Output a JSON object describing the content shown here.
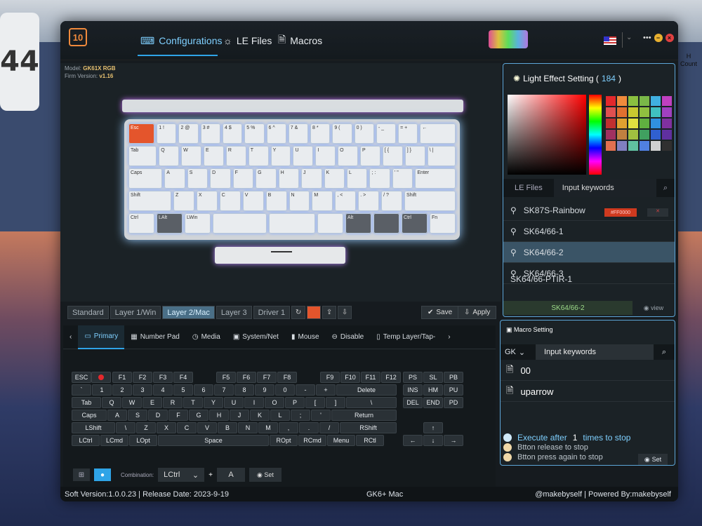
{
  "desktop": {
    "widget_number": "44",
    "right_label_1": "H",
    "right_label_2": "Count"
  },
  "app": {
    "logo": "10",
    "tabs": [
      {
        "label": "Configurations"
      },
      {
        "label": "LE Files"
      },
      {
        "label": "Macros"
      }
    ],
    "model_label": "Model:",
    "model_value": "GK61X RGB",
    "firm_label": "Firm Version:",
    "firm_value": "v1.16",
    "window_buttons": [
      "•••",
      "−",
      "×"
    ]
  },
  "keyboard": {
    "rows": [
      [
        "Esc",
        "1 !",
        "2 @",
        "3 #",
        "4 $",
        "5 %",
        "6 ^",
        "7 &",
        "8 *",
        "9 (",
        "0 )",
        "- _",
        "= +",
        "←"
      ],
      [
        "Tab",
        "Q",
        "W",
        "E",
        "R",
        "T",
        "Y",
        "U",
        "I",
        "O",
        "P",
        "[ {",
        "] }",
        "\\ |"
      ],
      [
        "Caps",
        "A",
        "S",
        "D",
        "F",
        "G",
        "H",
        "J",
        "K",
        "L",
        "; :",
        "' \"",
        "Enter"
      ],
      [
        "Shift",
        "Z",
        "X",
        "C",
        "V",
        "B",
        "N",
        "M",
        ", <",
        ". >",
        "/ ?",
        "Shift"
      ],
      [
        "Ctrl",
        "LAlt",
        "LWin",
        "",
        "",
        "",
        "Alt",
        "",
        "Ctrl",
        "Fn"
      ]
    ]
  },
  "layers": {
    "items": [
      {
        "label": "Standard"
      },
      {
        "label": "Layer 1/Win"
      },
      {
        "label": "Layer 2/Mac"
      },
      {
        "label": "Layer 3"
      },
      {
        "label": "Driver 1"
      }
    ],
    "save_label": "Save",
    "apply_label": "Apply"
  },
  "light_effect": {
    "title": "Light Effect Setting (",
    "count": "184",
    "close": ")",
    "hex": "#FF0000",
    "swatches": [
      "#e4282c",
      "#f08a3c",
      "#8ac040",
      "#7ab848",
      "#40b0e0",
      "#c040c0",
      "#e05050",
      "#e07030",
      "#c8c830",
      "#90c040",
      "#40c0c0",
      "#a040c0",
      "#c03030",
      "#e0a030",
      "#e0e040",
      "#60b040",
      "#3090e0",
      "#8030a0",
      "#a03060",
      "#c08040",
      "#a0c040",
      "#40a060",
      "#3060d0",
      "#6030a0",
      "#e07050",
      "#8080c0",
      "#60c0a0",
      "#5080e0",
      "#d0d0d0",
      "#303030"
    ],
    "tab_le": "LE Files",
    "input_placeholder": "Input keywords",
    "files": [
      {
        "name": "SK87S-Rainbow"
      },
      {
        "name": "SK64/66-1"
      },
      {
        "name": "SK64/66-2"
      },
      {
        "name": "SK64/66-3"
      },
      {
        "name": "SK64/66-PTIR-1"
      }
    ],
    "selected_name": "SK64/66-2",
    "view_label": "view"
  },
  "macro": {
    "title": "Macro Setting",
    "group_sel": "GK",
    "input_placeholder": "Input keywords",
    "items": [
      {
        "name": "00"
      },
      {
        "name": "uparrow"
      }
    ],
    "opt_execute_prefix": "Execute after",
    "opt_execute_count": "1",
    "opt_execute_suffix": "times to stop",
    "opt_release": "Btton release to stop",
    "opt_press": "Btton press again to stop",
    "set_label": "Set"
  },
  "categories": [
    {
      "label": "Primary"
    },
    {
      "label": "Number Pad"
    },
    {
      "label": "Media"
    },
    {
      "label": "System/Net"
    },
    {
      "label": "Mouse"
    },
    {
      "label": "Disable"
    },
    {
      "label": "Temp Layer/Tap-"
    }
  ],
  "combo": {
    "label": "Combination:",
    "mod": "LCtrl",
    "plus": "+",
    "key": "A",
    "set_label": "Set"
  },
  "status": {
    "left": "Soft Version:1.0.0.23 | Release Date: 2023-9-19",
    "center": "GK6+ Mac",
    "right": "@makebyself | Powered By:makebyself"
  }
}
